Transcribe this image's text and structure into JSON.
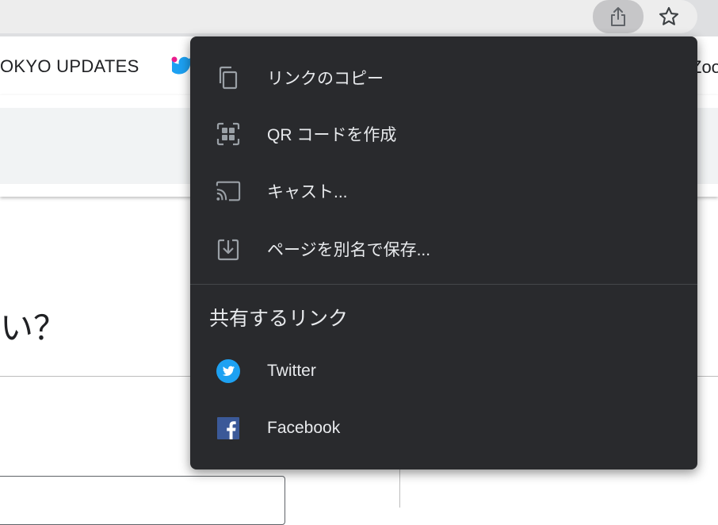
{
  "bookmarks": {
    "item_text": "OKYO UPDATES",
    "right_partial": "Zoo"
  },
  "page": {
    "question_fragment": "い？"
  },
  "share_menu": {
    "items": [
      {
        "label": "リンクのコピー",
        "icon": "copy-icon"
      },
      {
        "label": "QR コードを作成",
        "icon": "qr-code-icon"
      },
      {
        "label": "キャスト...",
        "icon": "cast-icon"
      },
      {
        "label": "ページを別名で保存...",
        "icon": "save-page-icon"
      }
    ],
    "section_title": "共有するリンク",
    "share_targets": [
      {
        "label": "Twitter",
        "icon": "twitter-icon",
        "color": "#1da1f2"
      },
      {
        "label": "Facebook",
        "icon": "facebook-icon",
        "color": "#3b5998"
      }
    ]
  },
  "colors": {
    "menu_bg": "#292a2d",
    "menu_text": "#e8eaed",
    "icon_grey": "#9aa0a6"
  }
}
